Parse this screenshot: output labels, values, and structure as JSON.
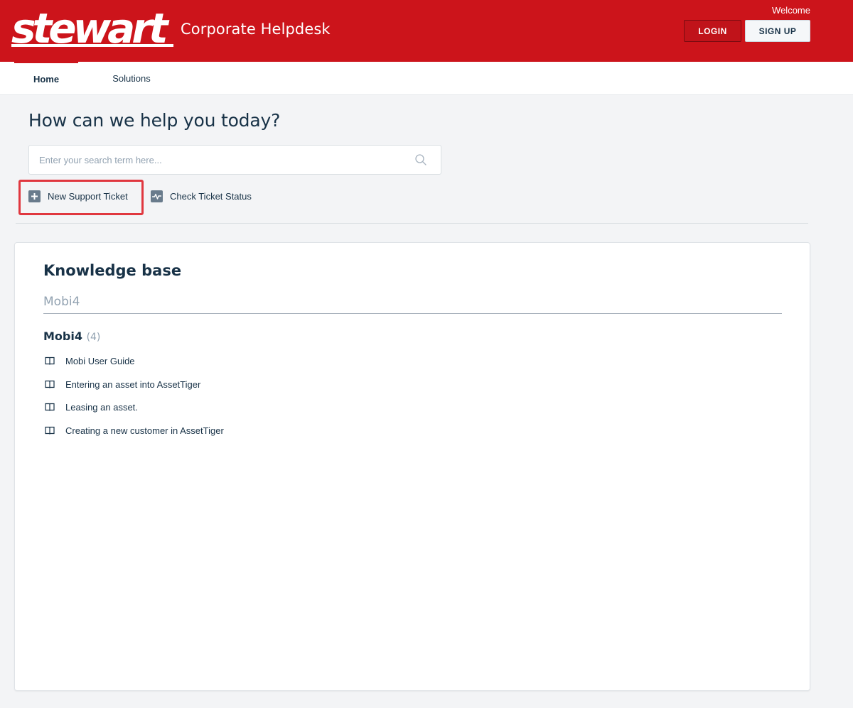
{
  "header": {
    "logo_text": "stewart",
    "title": "Corporate Helpdesk",
    "welcome": "Welcome",
    "login_label": "LOGIN",
    "signup_label": "SIGN UP",
    "brand_color": "#cc141b"
  },
  "nav": {
    "tabs": [
      {
        "label": "Home",
        "active": true
      },
      {
        "label": "Solutions",
        "active": false
      }
    ]
  },
  "hero": {
    "title": "How can we help you today?",
    "search_placeholder": "Enter your search term here...",
    "search_icon": "search-icon",
    "actions": [
      {
        "label": "New Support Ticket",
        "icon": "plus-icon",
        "highlighted": true
      },
      {
        "label": "Check Ticket Status",
        "icon": "pulse-icon",
        "highlighted": false
      }
    ]
  },
  "knowledge_base": {
    "title": "Knowledge base",
    "category_tab": "Mobi4",
    "folder": {
      "name": "Mobi4",
      "count": "(4)",
      "articles": [
        "Mobi User Guide",
        "Entering an asset into AssetTiger",
        "Leasing an asset.",
        "Creating a new customer in AssetTiger"
      ]
    }
  }
}
